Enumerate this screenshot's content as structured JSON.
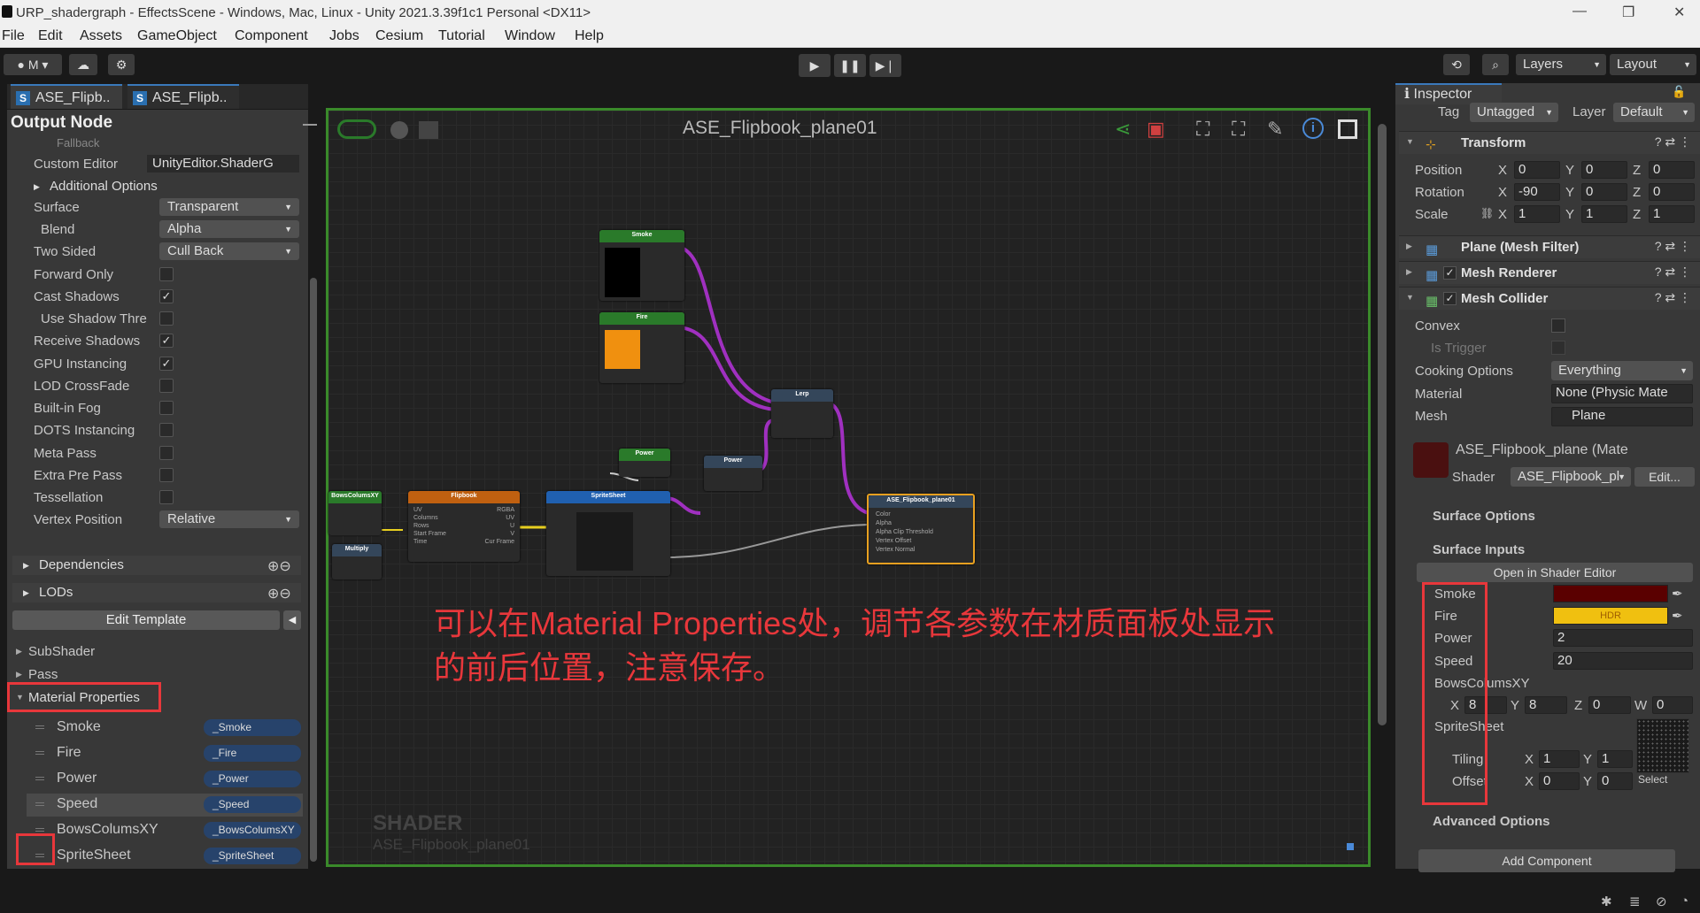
{
  "window": {
    "title": "URP_shadergraph - EffectsScene - Windows, Mac, Linux - Unity 2021.3.39f1c1 Personal <DX11>"
  },
  "menu": [
    "File",
    "Edit",
    "Assets",
    "GameObject",
    "Component",
    "Jobs",
    "Cesium",
    "Tutorial",
    "Window",
    "Help"
  ],
  "toolbar": {
    "account": "M",
    "layers": "Layers",
    "layout": "Layout"
  },
  "tabs": [
    "ASE_Flipb..",
    "ASE_Flipb.."
  ],
  "left": {
    "title": "Output Node",
    "fallback": "Fallback",
    "custom_editor_label": "Custom Editor",
    "custom_editor_value": "UnityEditor.ShaderG",
    "additional_options": "Additional Options",
    "surface_label": "Surface",
    "surface_value": "Transparent",
    "blend_label": "Blend",
    "blend_value": "Alpha",
    "two_sided_label": "Two Sided",
    "two_sided_value": "Cull Back",
    "forward_only": "Forward Only",
    "cast_shadows": "Cast Shadows",
    "use_shadow": "Use Shadow Thre",
    "receive_shadows": "Receive Shadows",
    "gpu_instancing": "GPU Instancing",
    "lod_crossfade": "LOD CrossFade",
    "builtin_fog": "Built-in Fog",
    "dots_instancing": "DOTS Instancing",
    "meta_pass": "Meta Pass",
    "extra_pre_pass": "Extra Pre Pass",
    "tessellation": "Tessellation",
    "vertex_position_label": "Vertex Position",
    "vertex_position_value": "Relative",
    "dependencies": "Dependencies",
    "lods": "LODs",
    "edit_template": "Edit Template",
    "subshader": "SubShader",
    "pass": "Pass",
    "material_properties": "Material Properties",
    "props": [
      {
        "name": "Smoke",
        "value": "_Smoke"
      },
      {
        "name": "Fire",
        "value": "_Fire"
      },
      {
        "name": "Power",
        "value": "_Power"
      },
      {
        "name": "Speed",
        "value": "_Speed"
      },
      {
        "name": "BowsColumsXY",
        "value": "_BowsColumsXY"
      },
      {
        "name": "SpriteSheet",
        "value": "_SpriteSheet"
      }
    ]
  },
  "graph": {
    "title": "ASE_Flipbook_plane01",
    "watermark_1": "SHADER",
    "watermark_2": "ASE_Flipbook_plane01",
    "annotation_1": "可以在Material Properties处，调节各参数在材质面板处显示",
    "annotation_2": "的前后位置，注意保存。",
    "nodes": {
      "smoke": "Smoke",
      "fire": "Fire",
      "lerp": "Lerp",
      "power_prop": "Power",
      "power_fn": "Power",
      "flipbook": "Flipbook",
      "spritesheet": "SpriteSheet",
      "output": "ASE_Flipbook_plane01",
      "rows": "BowsColumsXY",
      "multiply": "Multiply"
    },
    "out_ports": [
      "Color",
      "Alpha",
      "Alpha Clip Threshold",
      "Vertex Offset",
      "Vertex Normal"
    ],
    "flip_ports": [
      "UV",
      "Columns",
      "Rows",
      "Start Frame",
      "Time"
    ],
    "flip_outs": [
      "RGBA",
      "UV",
      "U",
      "V",
      "Cur Frame"
    ]
  },
  "inspector": {
    "tab": "Inspector",
    "tag_label": "Tag",
    "tag_value": "Untagged",
    "layer_label": "Layer",
    "layer_value": "Default",
    "transform": "Transform",
    "position_label": "Position",
    "rotation_label": "Rotation",
    "scale_label": "Scale",
    "position": [
      "0",
      "0",
      "0"
    ],
    "rotation": [
      "-90",
      "0",
      "0"
    ],
    "scale": [
      "1",
      "1",
      "1"
    ],
    "mesh_filter": "Plane (Mesh Filter)",
    "mesh_renderer": "Mesh Renderer",
    "mesh_collider": "Mesh Collider",
    "convex": "Convex",
    "is_trigger": "Is Trigger",
    "cooking_label": "Cooking Options",
    "cooking_value": "Everything",
    "material_label": "Material",
    "material_value": "None (Physic Mate",
    "mesh_label": "Mesh",
    "mesh_value": "Plane",
    "mat_name": "ASE_Flipbook_plane (Mate",
    "shader_label": "Shader",
    "shader_value": "ASE_Flipbook_pl",
    "edit": "Edit...",
    "surface_options": "Surface Options",
    "surface_inputs": "Surface Inputs",
    "open_editor": "Open in Shader Editor",
    "smoke": "Smoke",
    "fire": "Fire",
    "hdr": "HDR",
    "power_label": "Power",
    "power_value": "2",
    "speed_label": "Speed",
    "speed_value": "20",
    "bows": "BowsColumsXY",
    "bx": "8",
    "by": "8",
    "bz": "0",
    "bw": "0",
    "spritesheet": "SpriteSheet",
    "tiling": "Tiling",
    "offset": "Offset",
    "tx": "1",
    "ty": "1",
    "ox": "0",
    "oy": "0",
    "select": "Select",
    "advanced": "Advanced Options",
    "add_component": "Add Component",
    "colors": {
      "smoke": "#5a0000",
      "fire": "#f0c010"
    }
  }
}
